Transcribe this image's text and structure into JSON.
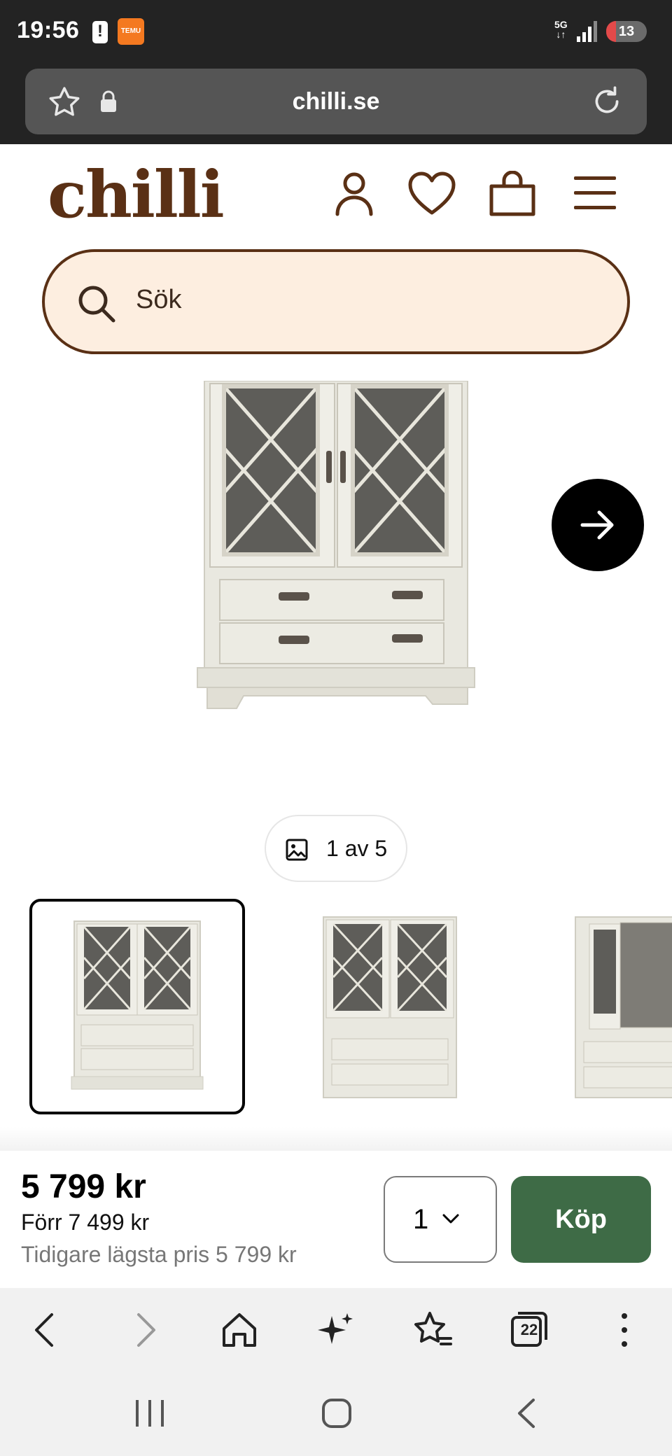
{
  "status_bar": {
    "time": "19:56",
    "network": "5G",
    "battery": "13",
    "notification_app": "TEMU"
  },
  "browser": {
    "url": "chilli.se",
    "tabs_count": "22"
  },
  "site": {
    "logo": "chilli",
    "search_placeholder": "Sök",
    "brand_color": "#5a3015",
    "search_bg": "#fdeee0"
  },
  "gallery": {
    "counter": "1 av 5",
    "thumbnails": [
      "cabinet-front-angled",
      "cabinet-front",
      "cabinet-open-side"
    ]
  },
  "buy_bar": {
    "price": "5 799 kr",
    "before_price": "Förr 7 499 kr",
    "lowest_price": "Tidigare lägsta pris 5 799 kr",
    "quantity": "1",
    "buy_label": "Köp",
    "buy_color": "#3e6b46"
  }
}
